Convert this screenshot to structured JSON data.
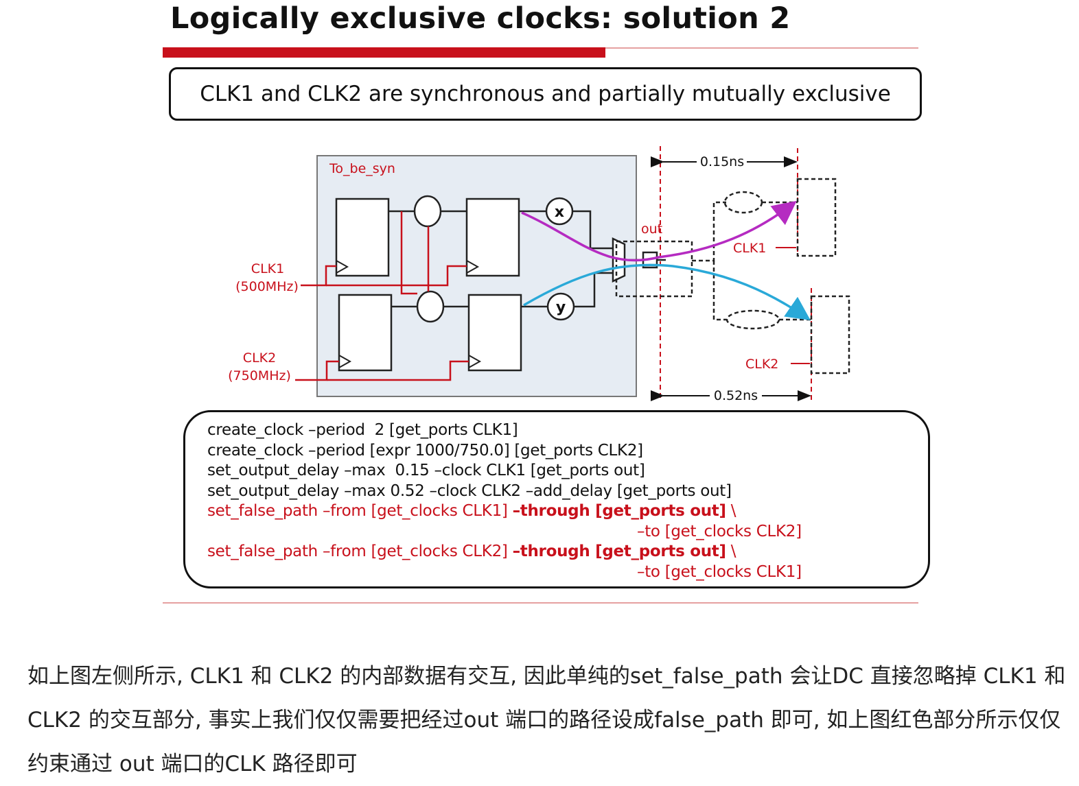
{
  "slide": {
    "title": "Logically exclusive clocks: solution 2",
    "subtitle": "CLK1 and CLK2 are synchronous and partially mutually exclusive"
  },
  "diagram": {
    "block_label": "To_be_syn",
    "clk1_name": "CLK1",
    "clk1_freq": "(500MHz)",
    "clk2_name": "CLK2",
    "clk2_freq": "(750MHz)",
    "gate_x": "x",
    "gate_y": "y",
    "out_label": "out",
    "delay_top": "0.15ns",
    "delay_bottom": "0.52ns",
    "ext_clk1": "CLK1",
    "ext_clk2": "CLK2",
    "colors": {
      "accent_red": "#c8101b",
      "block_fill": "#e6ecf3",
      "path_clk1": "#b52bc1",
      "path_clk2": "#2aa9d8"
    }
  },
  "code": {
    "l1": "create_clock –period  2 [get_ports CLK1]",
    "l2": "create_clock –period [expr 1000/750.0] [get_ports CLK2]",
    "l3": "set_output_delay –max  0.15 –clock CLK1 [get_ports out]",
    "l4": "set_output_delay –max 0.52 –clock CLK2 –add_delay [get_ports out]",
    "l5a": "set_false_path –from [get_clocks CLK1] ",
    "l5b": "–through [get_ports out]",
    "l5c": " \\",
    "l6": "–to [get_clocks CLK2]",
    "l7a": "set_false_path –from [get_clocks CLK2] ",
    "l7b": "–through [get_ports out]",
    "l7c": " \\",
    "l8": "–to [get_clocks CLK1]"
  },
  "caption": "如上图左侧所示, CLK1 和 CLK2 的内部数据有交互, 因此单纯的set_false_path 会让DC 直接忽略掉 CLK1 和 CLK2 的交互部分, 事实上我们仅仅需要把经过out 端口的路径设成false_path 即可, 如上图红色部分所示仅仅约束通过 out 端口的CLK 路径即可"
}
